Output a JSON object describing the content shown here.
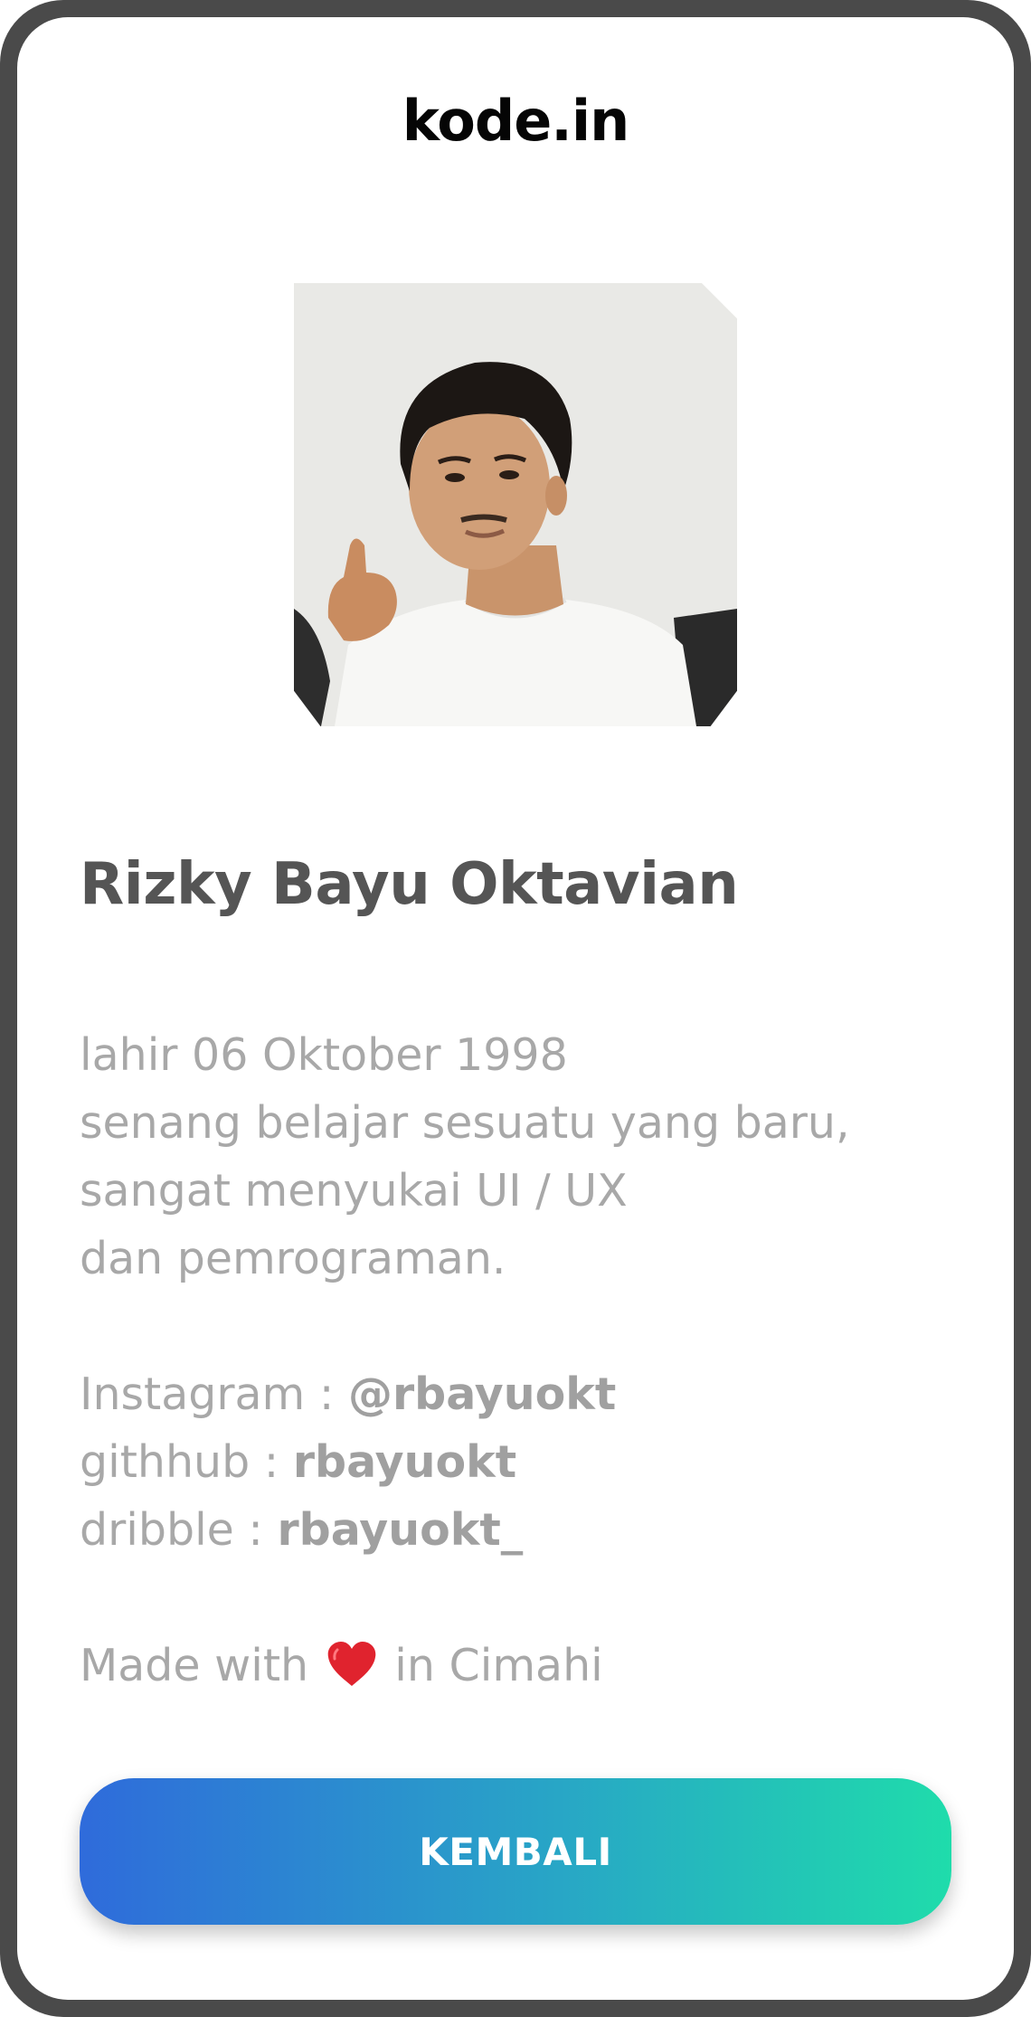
{
  "header": {
    "brand": "kode.in"
  },
  "profile": {
    "photo_alt": "profile-photo",
    "name": "Rizky Bayu Oktavian",
    "bio_lines": [
      "lahir 06 Oktober 1998",
      "senang belajar sesuatu yang baru,",
      "sangat menyukai UI / UX",
      "dan pemrograman."
    ],
    "socials": [
      {
        "label": "Instagram : ",
        "handle": "@rbayuokt"
      },
      {
        "label": "githhub : ",
        "handle": "rbayuokt"
      },
      {
        "label": "dribble : ",
        "handle": "rbayuokt_"
      }
    ],
    "footer": {
      "prefix": "Made with",
      "suffix": "in Cimahi",
      "heart_icon": "heart-icon"
    }
  },
  "actions": {
    "back_label": "KEMBALI"
  },
  "colors": {
    "frame": "#4a4a4a",
    "name_text": "#555555",
    "body_text": "#a8a8a8",
    "button_gradient_start": "#2f6bdb",
    "button_gradient_end": "#1fdcab",
    "heart": "#e0232e"
  }
}
